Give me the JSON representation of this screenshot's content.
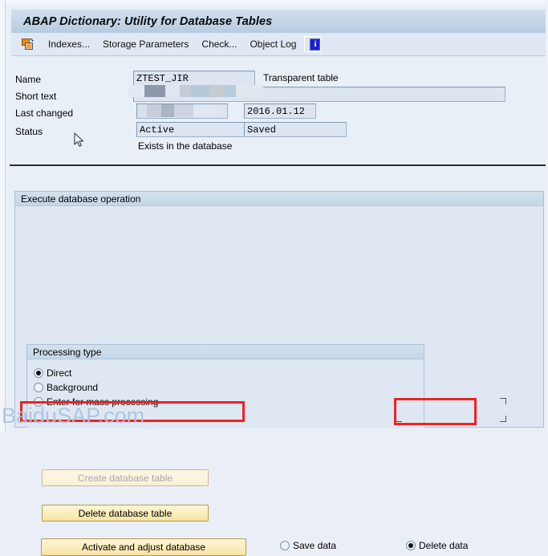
{
  "window": {
    "title": "ABAP Dictionary: Utility for Database Tables"
  },
  "toolbar": {
    "indexes_label": "Indexes...",
    "storage_parameters_label": "Storage Parameters",
    "check_label": "Check...",
    "object_log_label": "Object Log",
    "copy_icon_name": "indexes-icon",
    "info_icon_glyph": "i"
  },
  "form": {
    "name_label": "Name",
    "name_value": "ZTEST_JIR",
    "table_type_text": "Transparent table",
    "short_text_label": "Short text",
    "short_text_value": "",
    "last_changed_label": "Last changed",
    "last_changed_user": "",
    "last_changed_date": "2016.01.12",
    "status_label": "Status",
    "status_value": "Active",
    "saved_value": "Saved",
    "exists_text": "Exists in the database"
  },
  "execute_group": {
    "title": "Execute database operation",
    "processing_type": {
      "title": "Processing type",
      "options": [
        {
          "label": "Direct",
          "selected": true
        },
        {
          "label": "Background",
          "selected": false
        },
        {
          "label": "Enter for mass processing",
          "selected": false
        }
      ]
    },
    "buttons": {
      "create_database_table": "Create database table",
      "create_database_table_enabled": false,
      "delete_database_table": "Delete database table",
      "delete_database_table_enabled": true,
      "activate_and_adjust": "Activate and adjust database",
      "activate_and_adjust_enabled": true
    },
    "data_options": [
      {
        "label": "Save data",
        "selected": false
      },
      {
        "label": "Delete data",
        "selected": true
      }
    ]
  },
  "annotations": {
    "highlight_color": "#ee2222",
    "count": 2
  },
  "watermark": {
    "text": "BaiduSAP.com"
  }
}
